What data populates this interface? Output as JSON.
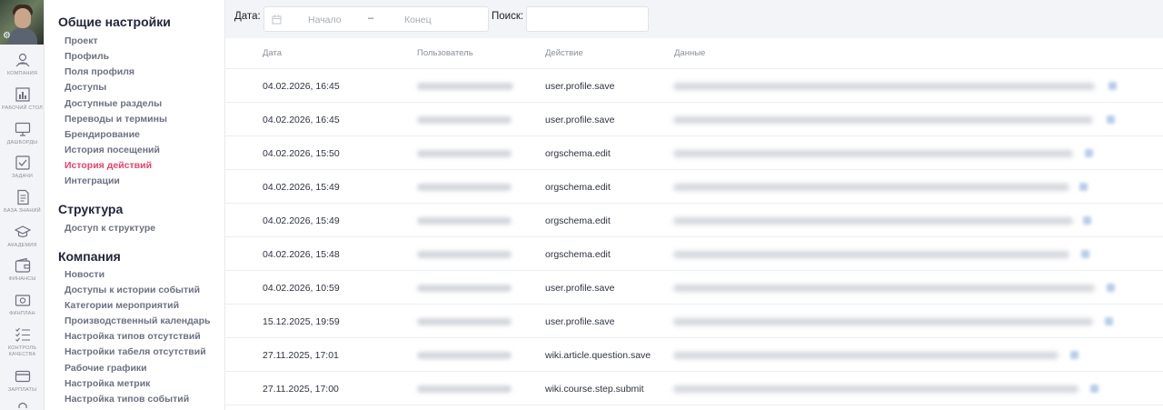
{
  "rail": {
    "items": [
      {
        "label": "КОМПАНИЯ",
        "icon": "company-icon"
      },
      {
        "label": "РАБОЧИЙ СТОЛ",
        "icon": "dashboard-icon"
      },
      {
        "label": "ДАШБОРДЫ",
        "icon": "monitor-icon"
      },
      {
        "label": "ЗАДАЧИ",
        "icon": "checkbox-icon"
      },
      {
        "label": "БАЗА ЗНАНИЙ",
        "icon": "document-icon"
      },
      {
        "label": "АКАДЕМИЯ",
        "icon": "graduation-cap-icon"
      },
      {
        "label": "ФИНАНСЫ",
        "icon": "wallet-icon"
      },
      {
        "label": "ФИНПЛАН",
        "icon": "money-icon"
      },
      {
        "label": "КОНТРОЛЬ",
        "label2": "КАЧЕСТВА",
        "icon": "checklist-icon"
      },
      {
        "label": "ЗАРПЛАТЫ",
        "icon": "card-icon"
      }
    ]
  },
  "menu": {
    "sections": [
      {
        "title": "Общие настройки",
        "items": [
          "Проект",
          "Профиль",
          "Поля профиля",
          "Доступы",
          "Доступные разделы",
          "Переводы и термины",
          "Брендирование",
          "История посещений",
          "История действий",
          "Интеграции"
        ],
        "active": "История действий"
      },
      {
        "title": "Структура",
        "items": [
          "Доступ к структуре"
        ]
      },
      {
        "title": "Компания",
        "items": [
          "Новости",
          "Доступы к истории событий",
          "Категории мероприятий",
          "Производственный календарь",
          "Настройка типов отсутствий",
          "Настройки табеля отсутствий",
          "Рабочие графики",
          "Настройка метрик",
          "Настройка типов событий"
        ]
      }
    ]
  },
  "filter": {
    "date_label": "Дата:",
    "start_placeholder": "Начало",
    "dash": "–",
    "end_placeholder": "Конец",
    "search_label": "Поиск:",
    "search_value": ""
  },
  "table": {
    "headers": [
      "Дата",
      "Пользователь",
      "Действие",
      "Данные"
    ],
    "rows": [
      {
        "date": "04.02.2026, 16:45",
        "action": "user.profile.save"
      },
      {
        "date": "04.02.2026, 16:45",
        "action": "user.profile.save"
      },
      {
        "date": "04.02.2026, 15:50",
        "action": "orgschema.edit"
      },
      {
        "date": "04.02.2026, 15:49",
        "action": "orgschema.edit"
      },
      {
        "date": "04.02.2026, 15:49",
        "action": "orgschema.edit"
      },
      {
        "date": "04.02.2026, 15:48",
        "action": "orgschema.edit"
      },
      {
        "date": "04.02.2026, 10:59",
        "action": "user.profile.save"
      },
      {
        "date": "15.12.2025, 19:59",
        "action": "user.profile.save"
      },
      {
        "date": "27.11.2025, 17:01",
        "action": "wiki.article.question.save"
      },
      {
        "date": "27.11.2025, 17:00",
        "action": "wiki.course.step.submit"
      }
    ]
  },
  "colors": {
    "accent": "#e8456a",
    "menu_text": "#6d7181",
    "heading": "#222638"
  }
}
